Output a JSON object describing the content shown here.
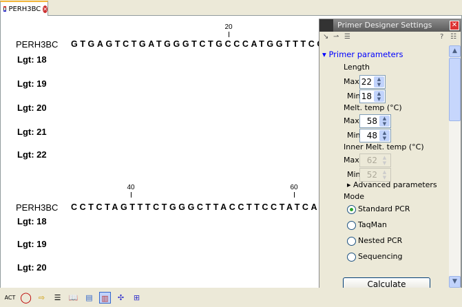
{
  "tab": {
    "label": "PERH3BC",
    "icon": "sequence-icon",
    "close_icon": "close-icon"
  },
  "editor": {
    "blocks": [
      {
        "name": "PERH3BC",
        "sequence": "GTGAGTCTGATGGGTCTGCCCATGGTTTCCT",
        "ruler": [
          "20"
        ],
        "lengths": [
          "Lgt: 18",
          "Lgt: 19",
          "Lgt: 20",
          "Lgt: 21",
          "Lgt: 22"
        ]
      },
      {
        "name": "PERH3BC",
        "sequence": "CCTCTAGTTTCTGGGCTTACCTTCCTATCAC",
        "ruler": [
          "40",
          "60"
        ],
        "lengths": [
          "Lgt: 18",
          "Lgt: 19",
          "Lgt: 20"
        ]
      }
    ]
  },
  "panel": {
    "title": "Primer Designer Settings",
    "help": "?",
    "section": "Primer parameters",
    "length_label": "Length",
    "length_max_label": "Max",
    "length_max": "22",
    "length_min_label": "Min",
    "length_min": "18",
    "melt_label": "Melt. temp (°C)",
    "melt_max_label": "Max",
    "melt_max": "58",
    "melt_min_label": "Min",
    "melt_min": "48",
    "inner_label": "Inner Melt. temp (°C)",
    "inner_max_label": "Max",
    "inner_max": "62",
    "inner_min_label": "Min",
    "inner_min": "52",
    "advanced": "Advanced parameters",
    "mode_label": "Mode",
    "modes": [
      "Standard PCR",
      "TaqMan",
      "Nested PCR",
      "Sequencing"
    ],
    "selected_mode": "Standard PCR",
    "calculate": "Calculate"
  },
  "bottom_toolbar": [
    "act-icon",
    "circular-view-icon",
    "table-export-icon",
    "list-icon",
    "book-icon",
    "text-view-icon",
    "sequence-view-icon",
    "primer-icon",
    "primer-table-icon"
  ]
}
